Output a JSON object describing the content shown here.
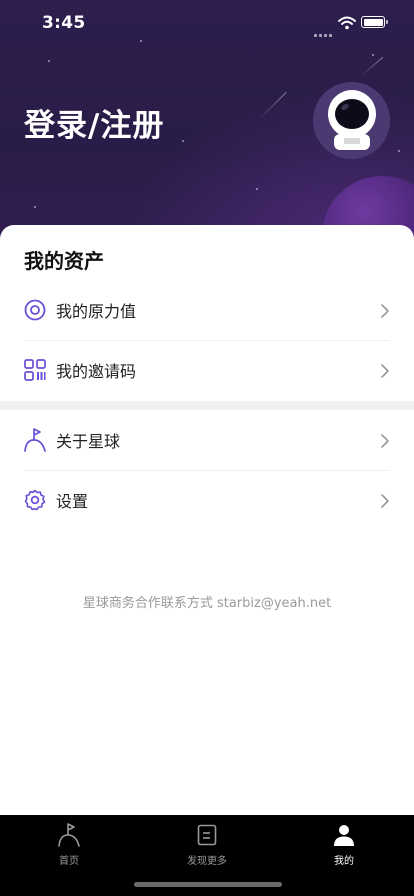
{
  "status_bar": {
    "time": "3:45"
  },
  "header": {
    "login_title": "登录/注册",
    "avatar_icon": "astronaut-icon"
  },
  "assets": {
    "section_title": "我的资产",
    "items": [
      {
        "label": "我的原力值",
        "icon": "target-circle-icon"
      },
      {
        "label": "我的邀请码",
        "icon": "qr-code-icon"
      }
    ]
  },
  "more": {
    "items": [
      {
        "label": "关于星球",
        "icon": "planet-flag-icon"
      },
      {
        "label": "设置",
        "icon": "gear-icon"
      }
    ]
  },
  "contact_text": "星球商务合作联系方式 starbiz@yeah.net",
  "tabbar": {
    "tabs": [
      {
        "label": "首页",
        "icon": "planet-flag-icon",
        "active": false
      },
      {
        "label": "发现更多",
        "icon": "document-icon",
        "active": false
      },
      {
        "label": "我的",
        "icon": "person-icon",
        "active": true
      }
    ]
  },
  "colors": {
    "accent": "#6b4fd8",
    "header_bg": "#2d1e4d",
    "tabbar_bg": "#000000"
  }
}
